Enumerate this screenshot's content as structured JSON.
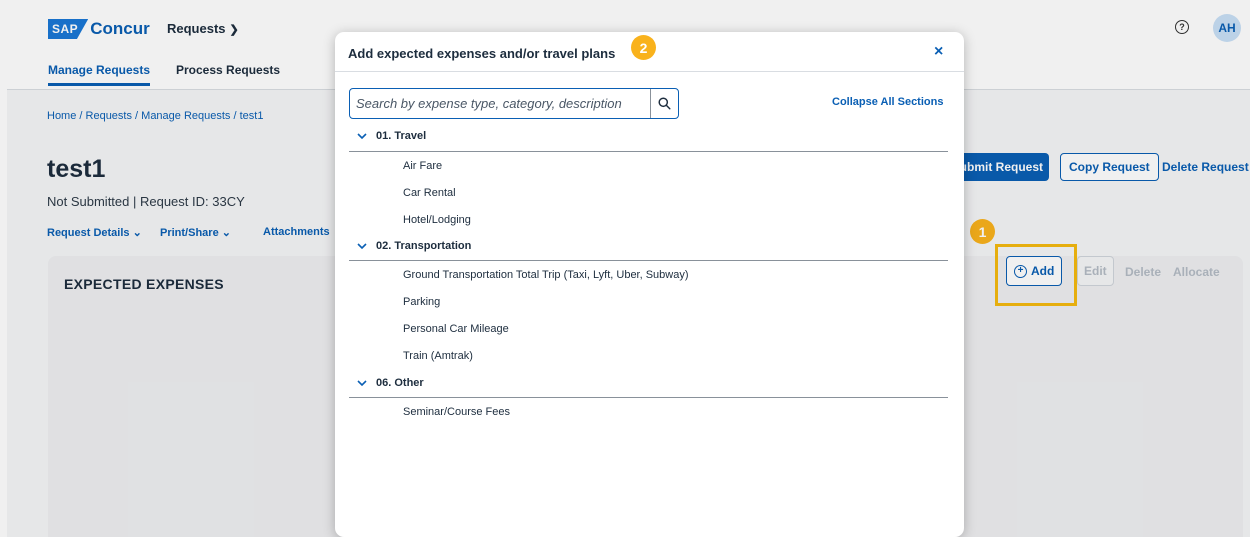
{
  "brand": {
    "sap": "SAP",
    "name": "Concur"
  },
  "header": {
    "app_menu": "Requests",
    "tabs": [
      {
        "label": "Manage Requests"
      },
      {
        "label": "Process Requests"
      }
    ],
    "help": "?",
    "avatar": "AH"
  },
  "breadcrumb": "Home / Requests / Manage Requests / test1",
  "request": {
    "title": "test1",
    "status_line": "Not Submitted  |  Request ID: 33CY",
    "subnav": [
      {
        "label": "Request Details"
      },
      {
        "label": "Print/Share"
      },
      {
        "label": "Attachments"
      }
    ],
    "actions": {
      "submit": "ubmit Request",
      "copy": "Copy Request",
      "delete": "Delete Request"
    }
  },
  "expenses": {
    "title": "EXPECTED EXPENSES",
    "add": "Add",
    "edit": "Edit",
    "delete": "Delete",
    "allocate": "Allocate"
  },
  "annotations": {
    "step1": "1",
    "step2": "2",
    "color": "#f9b21c"
  },
  "modal": {
    "title": "Add expected expenses and/or travel plans",
    "close": "×",
    "search_placeholder": "Search by expense type, category, description",
    "collapse_all": "Collapse All Sections",
    "sections": [
      {
        "title": "01. Travel",
        "items": [
          "Air Fare",
          "Car Rental",
          "Hotel/Lodging"
        ]
      },
      {
        "title": "02. Transportation",
        "items": [
          "Ground Transportation Total Trip (Taxi, Lyft, Uber, Subway)",
          "Parking",
          "Personal Car Mileage",
          "Train (Amtrak)"
        ]
      },
      {
        "title": "06. Other",
        "items": [
          "Seminar/Course Fees"
        ]
      }
    ]
  },
  "colors": {
    "primary": "#0a5fb4",
    "highlight": "#f5b90f"
  }
}
